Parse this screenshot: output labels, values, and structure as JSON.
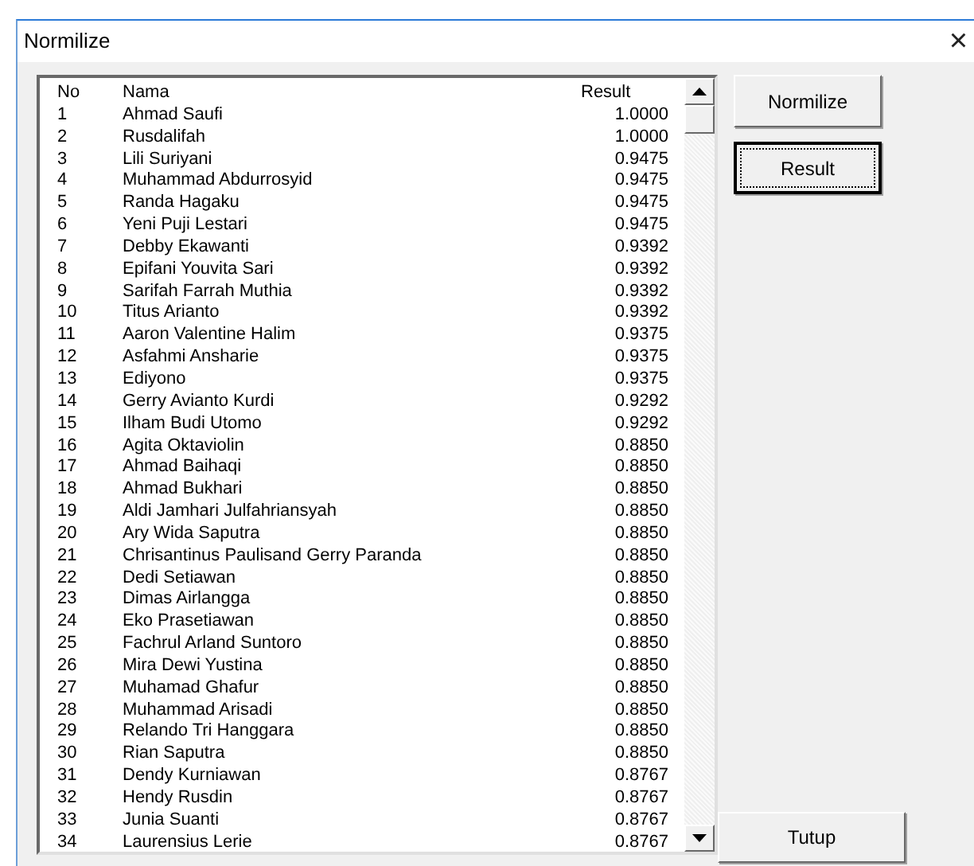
{
  "window": {
    "title": "Normilize",
    "close": "×"
  },
  "list": {
    "columns": [
      "No",
      "Nama",
      "Result"
    ],
    "rows": [
      [
        "1",
        "Ahmad Saufi",
        "1.0000"
      ],
      [
        "2",
        "Rusdalifah",
        "1.0000"
      ],
      [
        "3",
        "Lili Suriyani",
        "0.9475"
      ],
      [
        "4",
        "Muhammad Abdurrosyid",
        "0.9475"
      ],
      [
        "5",
        "Randa Hagaku",
        "0.9475"
      ],
      [
        "6",
        "Yeni Puji Lestari",
        "0.9475"
      ],
      [
        "7",
        "Debby Ekawanti",
        "0.9392"
      ],
      [
        "8",
        "Epifani Youvita Sari",
        "0.9392"
      ],
      [
        "9",
        "Sarifah Farrah Muthia",
        "0.9392"
      ],
      [
        "10",
        "Titus Arianto",
        "0.9392"
      ],
      [
        "11",
        "Aaron Valentine Halim",
        "0.9375"
      ],
      [
        "12",
        "Asfahmi Ansharie",
        "0.9375"
      ],
      [
        "13",
        "Ediyono",
        "0.9375"
      ],
      [
        "14",
        "Gerry Avianto Kurdi",
        "0.9292"
      ],
      [
        "15",
        "Ilham Budi Utomo",
        "0.9292"
      ],
      [
        "16",
        "Agita Oktaviolin",
        "0.8850"
      ],
      [
        "17",
        "Ahmad Baihaqi",
        "0.8850"
      ],
      [
        "18",
        "Ahmad Bukhari",
        "0.8850"
      ],
      [
        "19",
        "Aldi Jamhari Julfahriansyah",
        "0.8850"
      ],
      [
        "20",
        "Ary Wida Saputra",
        "0.8850"
      ],
      [
        "21",
        "Chrisantinus  Paulisand Gerry Paranda",
        "0.8850"
      ],
      [
        "22",
        "Dedi Setiawan",
        "0.8850"
      ],
      [
        "23",
        "Dimas Airlangga",
        "0.8850"
      ],
      [
        "24",
        "Eko Prasetiawan",
        "0.8850"
      ],
      [
        "25",
        "Fachrul Arland Suntoro",
        "0.8850"
      ],
      [
        "26",
        "Mira Dewi Yustina",
        "0.8850"
      ],
      [
        "27",
        "Muhamad Ghafur",
        "0.8850"
      ],
      [
        "28",
        "Muhammad Arisadi",
        "0.8850"
      ],
      [
        "29",
        "Relando Tri Hanggara",
        "0.8850"
      ],
      [
        "30",
        "Rian Saputra",
        "0.8850"
      ],
      [
        "31",
        "Dendy Kurniawan",
        "0.8767"
      ],
      [
        "32",
        "Hendy Rusdin",
        "0.8767"
      ],
      [
        "33",
        "Junia Suanti",
        "0.8767"
      ],
      [
        "34",
        "Laurensius Lerie",
        "0.8767"
      ]
    ]
  },
  "buttons": [
    {
      "label": "Normilize",
      "focused": false
    },
    {
      "label": "Result",
      "focused": true
    }
  ],
  "close_button": {
    "label": "Tutup",
    "focused": false
  }
}
